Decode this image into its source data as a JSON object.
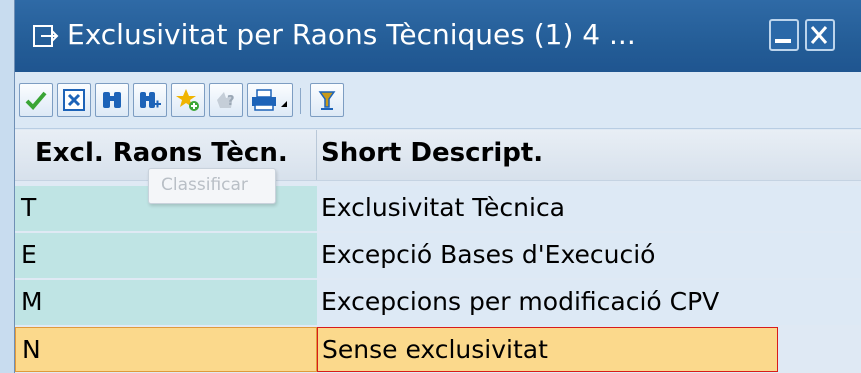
{
  "window": {
    "title": "Exclusivitat per Raons Tècniques (1)   4 ..."
  },
  "toolbar": {
    "buttons": [
      {
        "name": "checkmark-icon",
        "color": "#3aa535"
      },
      {
        "name": "cancel-icon",
        "color": "#1d63b8"
      },
      {
        "name": "binoculars-icon",
        "color": "#1d63b8"
      },
      {
        "name": "binoculars-plus-icon",
        "color": "#1d63b8"
      },
      {
        "name": "star-add-icon",
        "color": "#f0b400"
      },
      {
        "name": "help-icon",
        "color": "#9aa7b5"
      },
      {
        "name": "printer-icon",
        "color": "#1d63b8"
      },
      {
        "name": "sort-icon",
        "color": "#c79a1b"
      }
    ]
  },
  "table": {
    "columns": [
      "Excl. Raons Tècn.",
      "Short Descript."
    ],
    "rows": [
      {
        "key": "T",
        "desc": "Exclusivitat Tècnica"
      },
      {
        "key": "E",
        "desc": "Excepció Bases d'Execució"
      },
      {
        "key": "M",
        "desc": "Excepcions per modificació CPV"
      },
      {
        "key": "N",
        "desc": "Sense exclusivitat",
        "selected": true
      }
    ]
  },
  "tooltip": {
    "text": "Classificar"
  },
  "colors": {
    "title_bar": "#245d97",
    "key_column": "#bfe4e4",
    "selected_row": "#fbd98c",
    "selected_border": "#d81b1b"
  }
}
